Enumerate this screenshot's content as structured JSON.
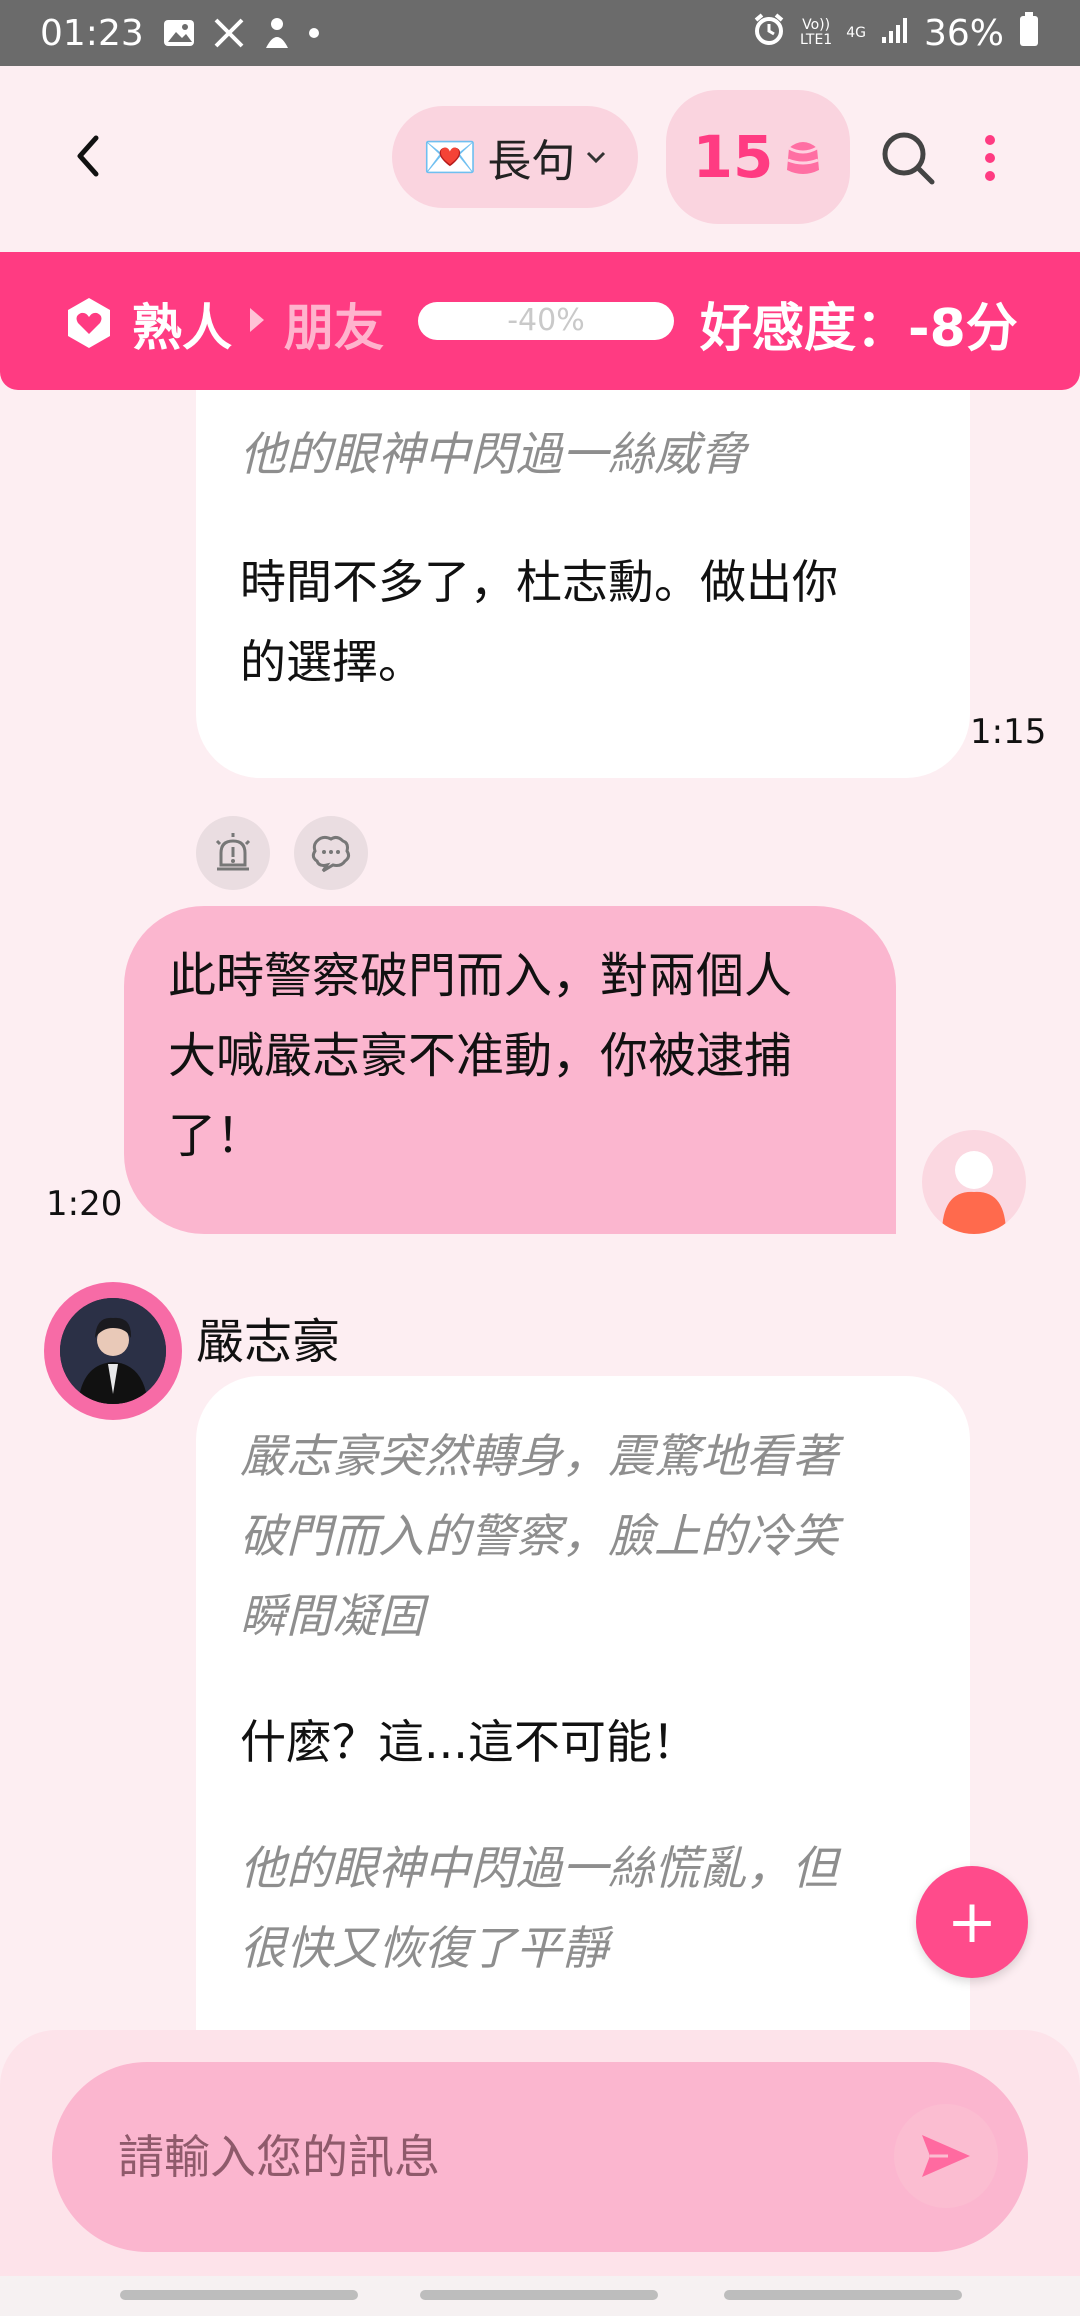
{
  "status_bar": {
    "time": "01:23",
    "network_top": "Vo))",
    "network_bottom": "LTE1",
    "network_type": "4G",
    "battery": "36%"
  },
  "header": {
    "mode_emoji": "💌",
    "mode_label": "長句",
    "credits": "15"
  },
  "relationship": {
    "current": "熟人",
    "next": "朋友",
    "progress_label": "-40%",
    "progress_value": -40,
    "score_label": "好感度：-8分"
  },
  "messages": {
    "ai_prev": {
      "narration": "他的眼神中閃過一絲威脅",
      "speech_line1": "時間不多了，杜志勳。做出你",
      "speech_line2": "的選擇。",
      "time": "1:15"
    },
    "user": {
      "line1": "此時警察破門而入，對兩個人",
      "line2": "大喊嚴志豪不准動，你被逮捕",
      "line3": "了！",
      "time": "1:20"
    },
    "ai": {
      "name": "嚴志豪",
      "narration1_line1": "嚴志豪突然轉身，震驚地看著",
      "narration1_line2": "破門而入的警察，臉上的冷笑",
      "narration1_line3": "瞬間凝固",
      "speech": "什麼？這...這不可能！",
      "narration2_line1": "他的眼神中閃過一絲慌亂，但",
      "narration2_line2": "很快又恢復了平靜"
    }
  },
  "fab_label": "+",
  "input": {
    "placeholder": "請輸入您的訊息"
  },
  "colors": {
    "accent": "#ff3b82",
    "bubble_user": "#fbb6cf",
    "background": "#fdeef2"
  },
  "icons": [
    "photo-icon",
    "x-icon",
    "app-icon",
    "alarm-icon",
    "signal-icon",
    "battery-icon",
    "back-icon",
    "chevron-down-icon",
    "pudding-icon",
    "search-icon",
    "more-icon",
    "shield-heart-icon",
    "alert-icon",
    "speech-bubble-icon",
    "send-icon"
  ]
}
